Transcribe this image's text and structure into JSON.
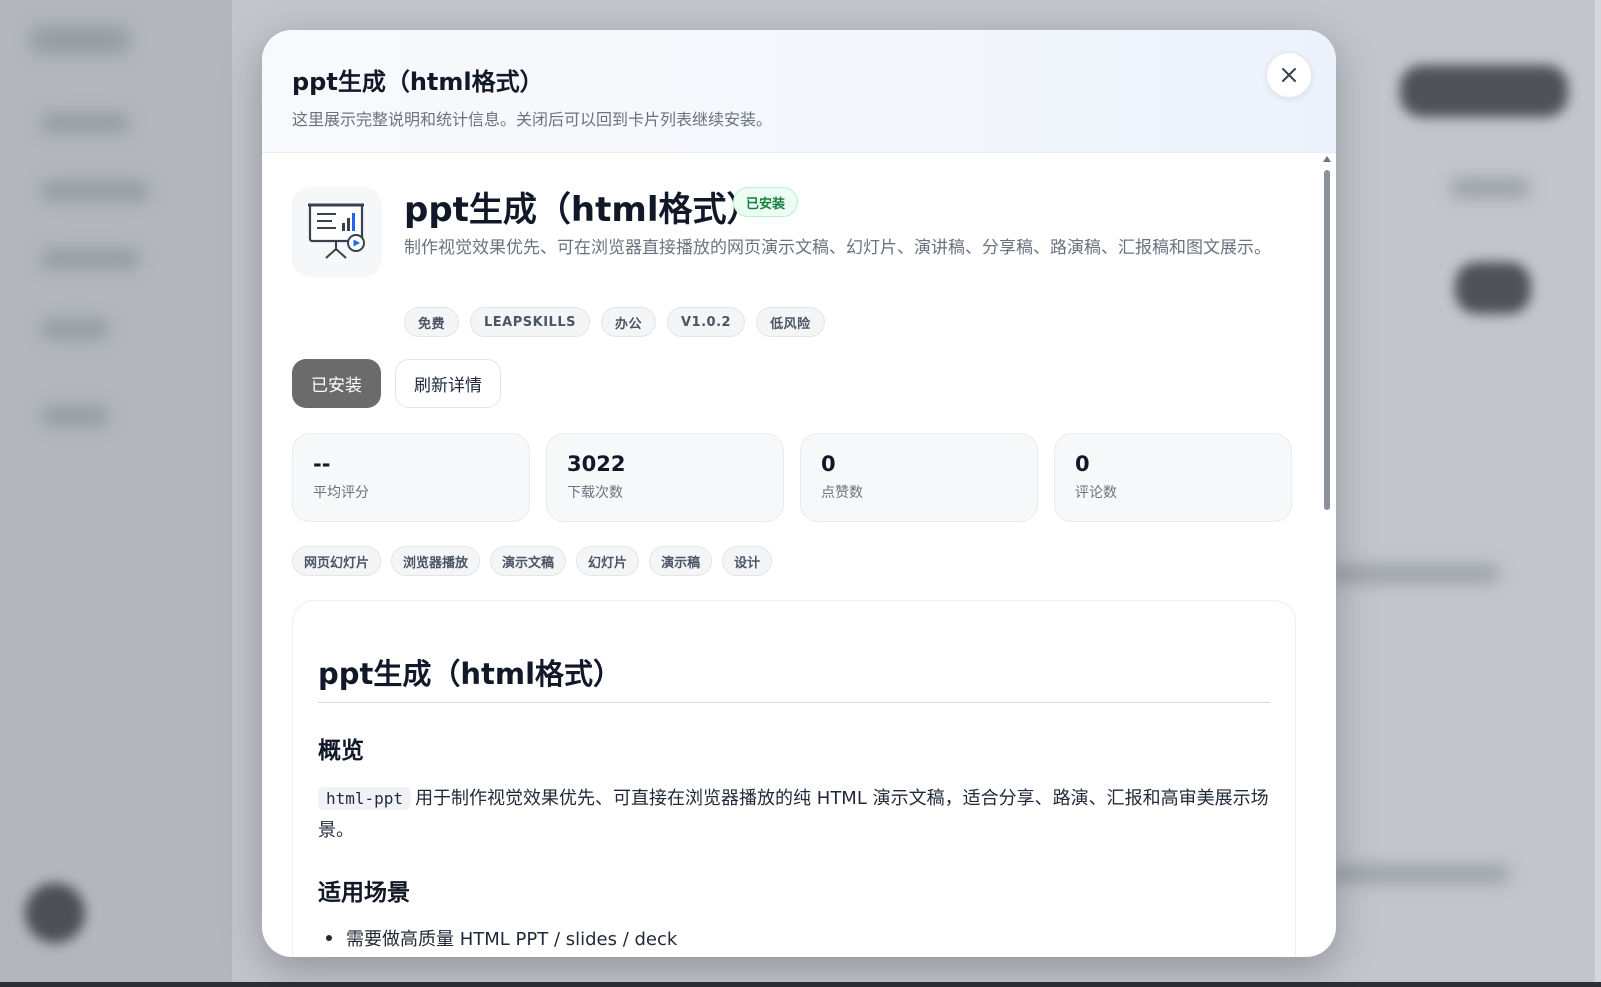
{
  "modal": {
    "title": "ppt生成（html格式）",
    "subtitle": "这里展示完整说明和统计信息。关闭后可以回到卡片列表继续安装。"
  },
  "skill": {
    "name": "ppt生成（html格式）",
    "status_badge": "已安装",
    "description": "制作视觉效果优先、可在浏览器直接播放的网页演示文稿、幻灯片、演讲稿、分享稿、路演稿、汇报稿和图文展示。",
    "tags": [
      "免费",
      "LEAPSKILLS",
      "办公",
      "V1.0.2",
      "低风险"
    ],
    "icon": "presentation-board-icon"
  },
  "actions": {
    "installed_label": "已安装",
    "refresh_label": "刷新详情"
  },
  "stats": [
    {
      "value": "--",
      "label": "平均评分"
    },
    {
      "value": "3022",
      "label": "下载次数"
    },
    {
      "value": "0",
      "label": "点赞数"
    },
    {
      "value": "0",
      "label": "评论数"
    }
  ],
  "keywords": [
    "网页幻灯片",
    "浏览器播放",
    "演示文稿",
    "幻灯片",
    "演示稿",
    "设计"
  ],
  "readme": {
    "h1": "ppt生成（html格式）",
    "overview_heading": "概览",
    "overview_code": "html-ppt",
    "overview_text": "用于制作视觉效果优先、可直接在浏览器播放的纯 HTML 演示文稿，适合分享、路演、汇报和高审美展示场景。",
    "scenarios_heading": "适用场景",
    "scenario_items": [
      "需要做高质量 HTML PPT / slides / deck"
    ]
  },
  "colors": {
    "accent_green": "#15803d",
    "primary_button": "#6b6b6b",
    "icon_blue": "#2563eb"
  }
}
